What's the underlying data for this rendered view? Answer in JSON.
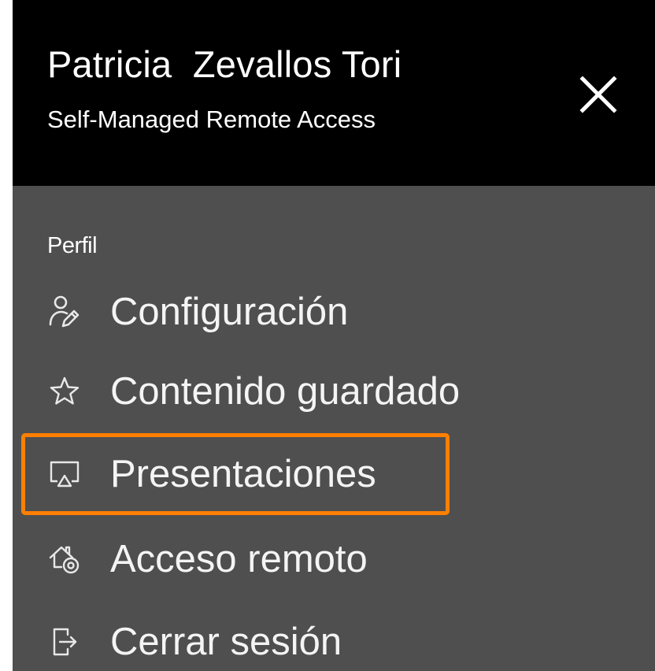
{
  "header": {
    "user_name": "Patricia  Zevallos Tori",
    "subtitle": "Self-Managed Remote Access"
  },
  "menu": {
    "section_label": "Perfil",
    "items": [
      {
        "label": "Configuración",
        "icon": "user-edit-icon"
      },
      {
        "label": "Contenido guardado",
        "icon": "star-icon"
      },
      {
        "label": "Presentaciones",
        "icon": "airplay-icon"
      },
      {
        "label": "Acceso remoto",
        "icon": "home-remote-icon"
      },
      {
        "label": "Cerrar sesión",
        "icon": "sign-out-icon"
      }
    ]
  },
  "colors": {
    "header_bg": "#000000",
    "menu_bg": "#4f4f4f",
    "text": "#ffffff",
    "highlight": "#ff7f00"
  }
}
